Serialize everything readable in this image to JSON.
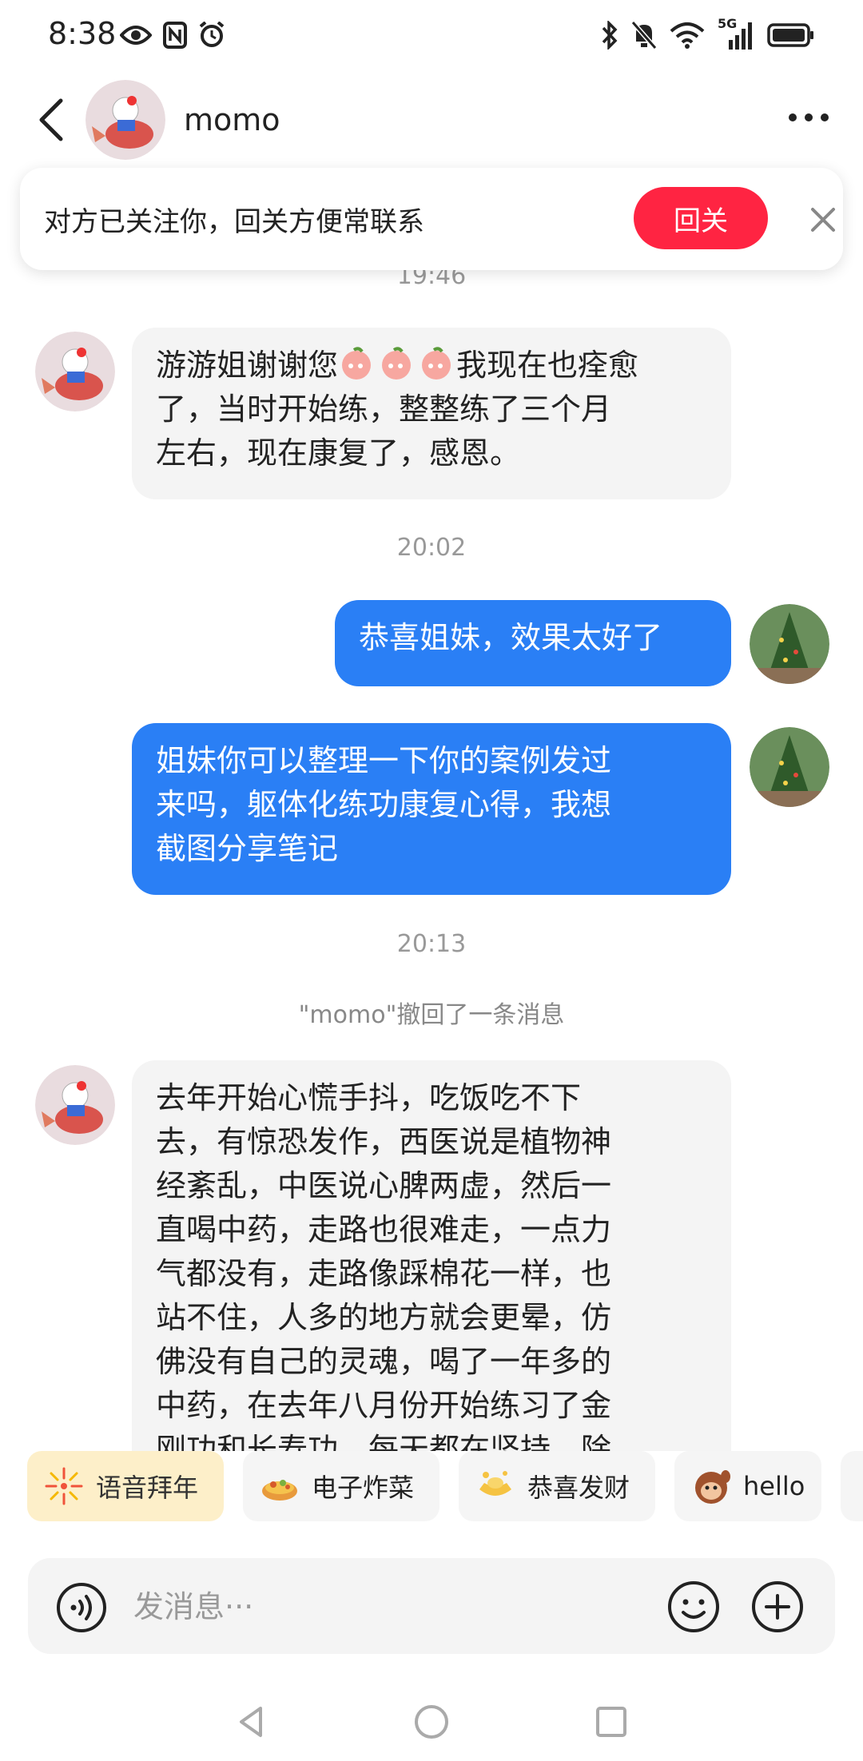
{
  "status_bar": {
    "time": "8:38",
    "left_icons": [
      "eye-icon",
      "nfc-icon",
      "alarm-icon"
    ],
    "right_icons": [
      "bluetooth-icon",
      "mute-icon",
      "wifi-icon",
      "signal-5g-icon",
      "battery-icon"
    ],
    "network_label": "5G"
  },
  "header": {
    "contact_name": "momo",
    "avatar": "avatar-hello-kitty-koi"
  },
  "follow_banner": {
    "text": "对方已关注你，回关方便常联系",
    "button_label": "回关"
  },
  "messages": [
    {
      "type": "timestamp",
      "text": "19:46"
    },
    {
      "type": "incoming",
      "text": "游游姐谢谢您🙏🙏🙏我现在也痊愈了，当时开始练，整整练了三个月左右，现在康复了，感恩。"
    },
    {
      "type": "timestamp",
      "text": "20:02"
    },
    {
      "type": "outgoing",
      "text": "恭喜姐妹，效果太好了"
    },
    {
      "type": "outgoing",
      "text": "姐妹你可以整理一下你的案例发过来吗，躯体化练功康复心得，我想截图分享笔记"
    },
    {
      "type": "timestamp",
      "text": "20:13"
    },
    {
      "type": "system",
      "text": "\"momo\"撤回了一条消息"
    },
    {
      "type": "incoming",
      "text": "去年开始心慌手抖，吃饭吃不下去，有惊恐发作，西医说是植物神经紊乱，中医说心脾两虚，然后一直喝中药，走路也很难走，一点力气都没有，走路像踩棉花一样，也站不住，人多的地方就会更晕，仿佛没有自己的灵魂，喝了一年多的中药，在去年八月份开始练习了金刚功和长寿功，每天都在坚持，除"
    }
  ],
  "incoming_1_lines": [
    "游游姐谢谢您",
    "我现在也痊愈",
    "了，当时开始练，整整练了三个月",
    "左右，现在康复了，感恩。"
  ],
  "incoming_2_lines": [
    "去年开始心慌手抖，吃饭吃不下",
    "去，有惊恐发作，西医说是植物神",
    "经紊乱，中医说心脾两虚，然后一",
    "直喝中药，走路也很难走，一点力",
    "气都没有，走路像踩棉花一样，也",
    "站不住，人多的地方就会更晕，仿",
    "佛没有自己的灵魂，喝了一年多的",
    "中药，在去年八月份开始练习了金",
    "刚功和长寿功，每天都在坚持，除"
  ],
  "outgoing_2_lines": [
    "姐妹你可以整理一下你的案例发过",
    "来吗，躯体化练功康复心得，我想",
    "截图分享笔记"
  ],
  "quick_replies": [
    {
      "label": "语音拜年",
      "icon": "firework-icon"
    },
    {
      "label": "电子炸菜",
      "icon": "fried-food-icon"
    },
    {
      "label": "恭喜发财",
      "icon": "gold-ingot-icon"
    },
    {
      "label": "hello",
      "icon": "monkey-wave-icon"
    }
  ],
  "input": {
    "placeholder": "发消息···"
  },
  "colors": {
    "accent_red": "#ff2442",
    "bubble_blue": "#2a7ff5",
    "bubble_gray": "#f4f4f4",
    "chip_gold": "#fdefc9"
  }
}
